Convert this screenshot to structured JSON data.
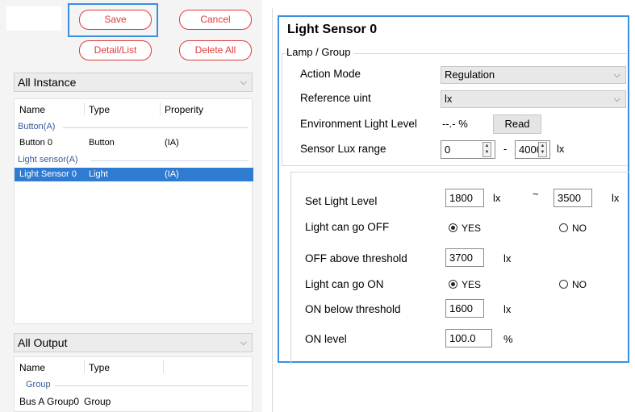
{
  "toolbar": {
    "save_label": "Save",
    "cancel_label": "Cancel",
    "detail_list_label": "Detail/List",
    "delete_all_label": "Delete All"
  },
  "instance_panel": {
    "combo_value": "All Instance",
    "columns": [
      "Name",
      "Type",
      "Properity"
    ],
    "groups": [
      {
        "label": "Button(A)",
        "rows": [
          {
            "name": "Button 0",
            "type": "Button",
            "property": "(IA)"
          }
        ]
      },
      {
        "label": "Light sensor(A)",
        "rows": [
          {
            "name": "Light Sensor 0",
            "type": "Light",
            "property": "(IA)",
            "selected": true
          }
        ]
      }
    ]
  },
  "output_panel": {
    "combo_value": "All Output",
    "columns": [
      "Name",
      "Type"
    ],
    "group_label": "Group",
    "rows": [
      {
        "name": "Bus A Group0",
        "type": "Group"
      }
    ]
  },
  "detail": {
    "title": "Light Sensor 0",
    "groupbox_label": "Lamp / Group",
    "action_mode_label": "Action Mode",
    "action_mode_value": "Regulation",
    "reference_unit_label": "Reference uint",
    "reference_unit_value": "lx",
    "env_light_label": "Environment Light Level",
    "env_light_value": "--.- %",
    "read_button": "Read",
    "sensor_range_label": "Sensor Lux range",
    "sensor_range_min": "0",
    "sensor_range_dash": "-",
    "sensor_range_max": "4000",
    "sensor_range_unit": "lx",
    "set_light_label": "Set Light Level",
    "set_light_min": "1800",
    "set_light_unit1": "lx",
    "set_light_tilde": "~",
    "set_light_max": "3500",
    "set_light_unit2": "lx",
    "can_off_label": "Light can go OFF",
    "can_off_yes": "YES",
    "can_off_no": "NO",
    "off_threshold_label": "OFF above threshold",
    "off_threshold_value": "3700",
    "off_threshold_unit": "lx",
    "can_on_label": "Light can go ON",
    "can_on_yes": "YES",
    "can_on_no": "NO",
    "on_threshold_label": "ON below threshold",
    "on_threshold_value": "1600",
    "on_threshold_unit": "lx",
    "on_level_label": "ON level",
    "on_level_value": "100.0",
    "on_level_unit": "%"
  },
  "chevron_glyph": "⌵",
  "spin_up_glyph": "▲",
  "spin_down_glyph": "▼",
  "colors": {
    "accent_blue": "#3a8ee0",
    "danger_red": "#e03a3a",
    "selection_blue": "#2f7bd1"
  }
}
